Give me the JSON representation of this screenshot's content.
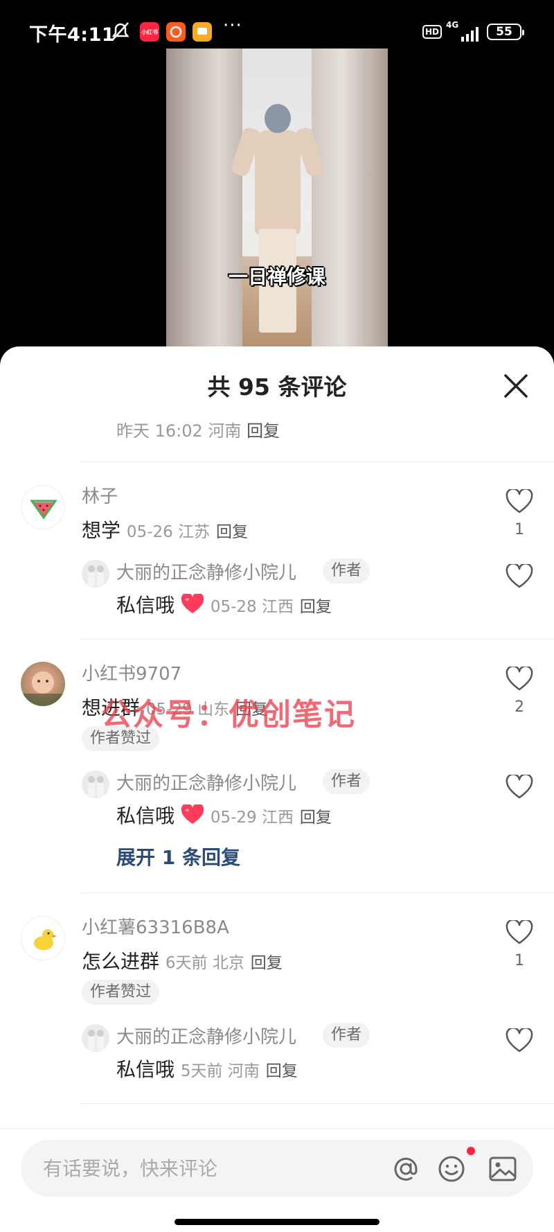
{
  "status_bar": {
    "time": "下午4:11",
    "app_badge_1": "小红书",
    "network_hd": "HD",
    "network_type": "4G",
    "battery": "55"
  },
  "video": {
    "caption": "一日禅修课"
  },
  "sheet": {
    "title": "共 95 条评论",
    "prev_meta": "昨天 16:02 河南",
    "prev_reply": "回复"
  },
  "comments": [
    {
      "user": "林子",
      "text": "想学",
      "meta": "05-26 江苏",
      "reply": "回复",
      "likes": "1",
      "sub": {
        "user": "大丽的正念静修小院儿",
        "tag": "作者",
        "text": "私信哦",
        "meta": "05-28 江西",
        "reply": "回复"
      }
    },
    {
      "user": "小红书9707",
      "text": "想进群",
      "meta": "05-29 山东",
      "reply": "回复",
      "likes": "2",
      "author_liked": "作者赞过",
      "sub": {
        "user": "大丽的正念静修小院儿",
        "tag": "作者",
        "text": "私信哦",
        "meta": "05-29 江西",
        "reply": "回复"
      },
      "expand": "展开 1 条回复"
    },
    {
      "user": "小红薯63316B8A",
      "text": "怎么进群",
      "meta": "6天前  北京",
      "reply": "回复",
      "likes": "1",
      "author_liked": "作者赞过",
      "sub": {
        "user": "大丽的正念静修小院儿",
        "tag": "作者",
        "text": "私信哦",
        "meta": "5天前  河南",
        "reply": "回复"
      }
    }
  ],
  "watermark": "公众号：优创笔记",
  "input": {
    "placeholder": "有话要说，快来评论"
  },
  "icons": {
    "close": "close-icon",
    "heart": "heart-outline-icon",
    "mention": "at-icon",
    "emoji": "emoji-icon",
    "image": "image-icon"
  },
  "colors": {
    "accent_red": "#ff2442",
    "link_blue": "#2b4a77"
  }
}
